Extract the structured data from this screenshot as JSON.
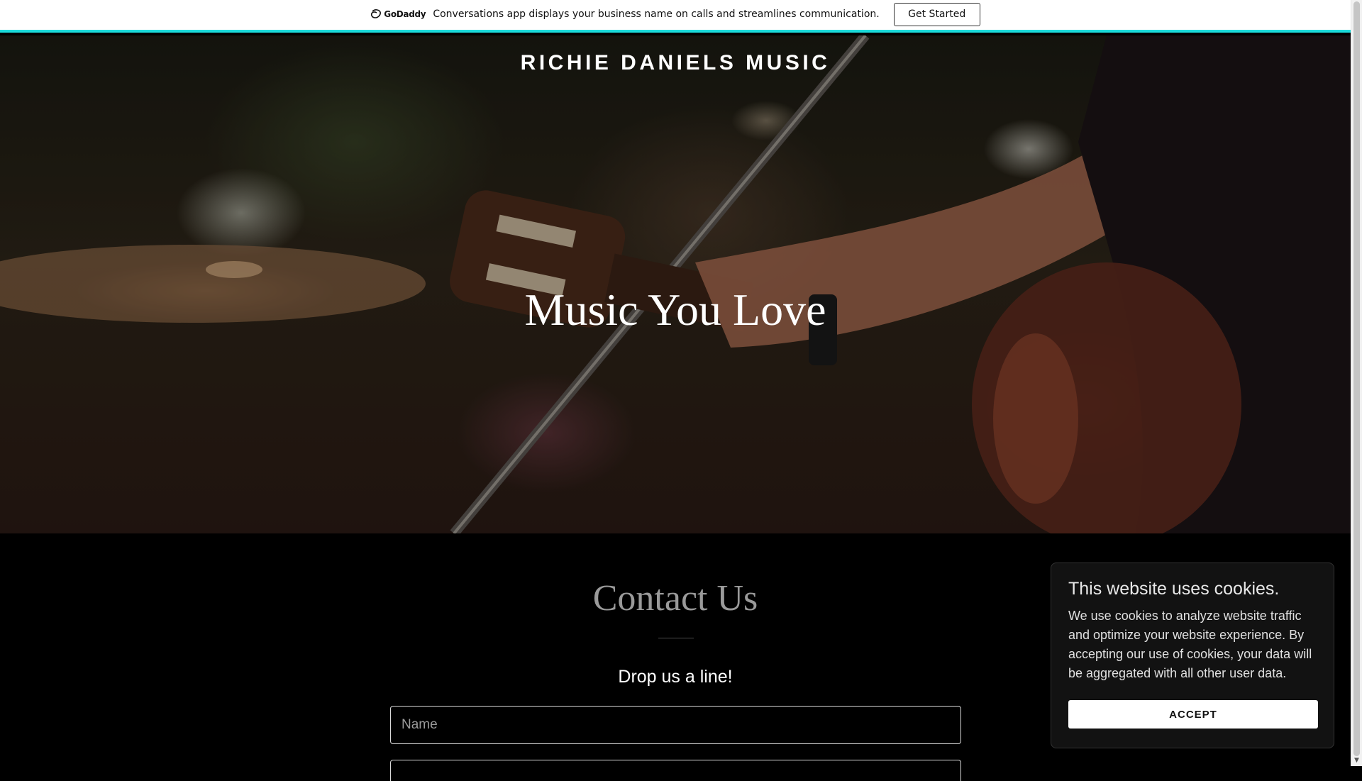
{
  "promo": {
    "brand": "GoDaddy",
    "message": "Conversations app displays your business name on calls and streamlines communication.",
    "cta_label": "Get Started",
    "accent_color": "#1bdbdb"
  },
  "header": {
    "site_title": "RICHIE DANIELS MUSIC"
  },
  "hero": {
    "heading": "Music You Love"
  },
  "contact": {
    "title": "Contact Us",
    "subtitle": "Drop us a line!",
    "name_placeholder": "Name"
  },
  "cookie_banner": {
    "title": "This website uses cookies.",
    "body": "We use cookies to analyze website traffic and optimize your website experience. By accepting our use of cookies, your data will be aggregated with all other user data.",
    "accept_label": "ACCEPT"
  }
}
